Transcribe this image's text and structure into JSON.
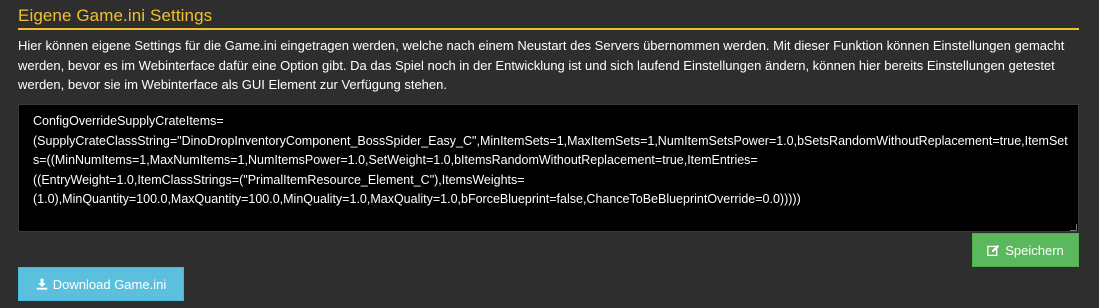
{
  "section": {
    "title": "Eigene Game.ini Settings",
    "description": "Hier können eigene Settings für die Game.ini eingetragen werden, welche nach einem Neustart des Servers übernommen werden. Mit dieser Funktion können Einstellungen gemacht werden, bevor es im Webinterface dafür eine Option gibt. Da das Spiel noch in der Entwicklung ist und sich laufend Einstellungen ändern, können hier bereits Einstellungen getestet werden, bevor sie im Webinterface als GUI Element zur Verfügung stehen."
  },
  "editor": {
    "value": "ConfigOverrideSupplyCrateItems=\n(SupplyCrateClassString=\"DinoDropInventoryComponent_BossSpider_Easy_C\",MinItemSets=1,MaxItemSets=1,NumItemSetsPower=1.0,bSetsRandomWithoutReplacement=true,ItemSets=((MinNumItems=1,MaxNumItems=1,NumItemsPower=1.0,SetWeight=1.0,bItemsRandomWithoutReplacement=true,ItemEntries=\n((EntryWeight=1.0,ItemClassStrings=(\"PrimalItemResource_Element_C\"),ItemsWeights=\n(1.0),MinQuantity=100.0,MaxQuantity=100.0,MinQuality=1.0,MaxQuality=1.0,bForceBlueprint=false,ChanceToBeBlueprintOverride=0.0)))))"
  },
  "buttons": {
    "save_label": "Speichern",
    "download_label": "Download Game.ini"
  },
  "icons": {
    "save": "edit-icon",
    "download": "download-icon"
  },
  "colors": {
    "background": "#2e2e2e",
    "title_accent": "#f0c030",
    "save_button": "#5cb85c",
    "download_button": "#5bc0de",
    "editor_background": "#000000"
  }
}
